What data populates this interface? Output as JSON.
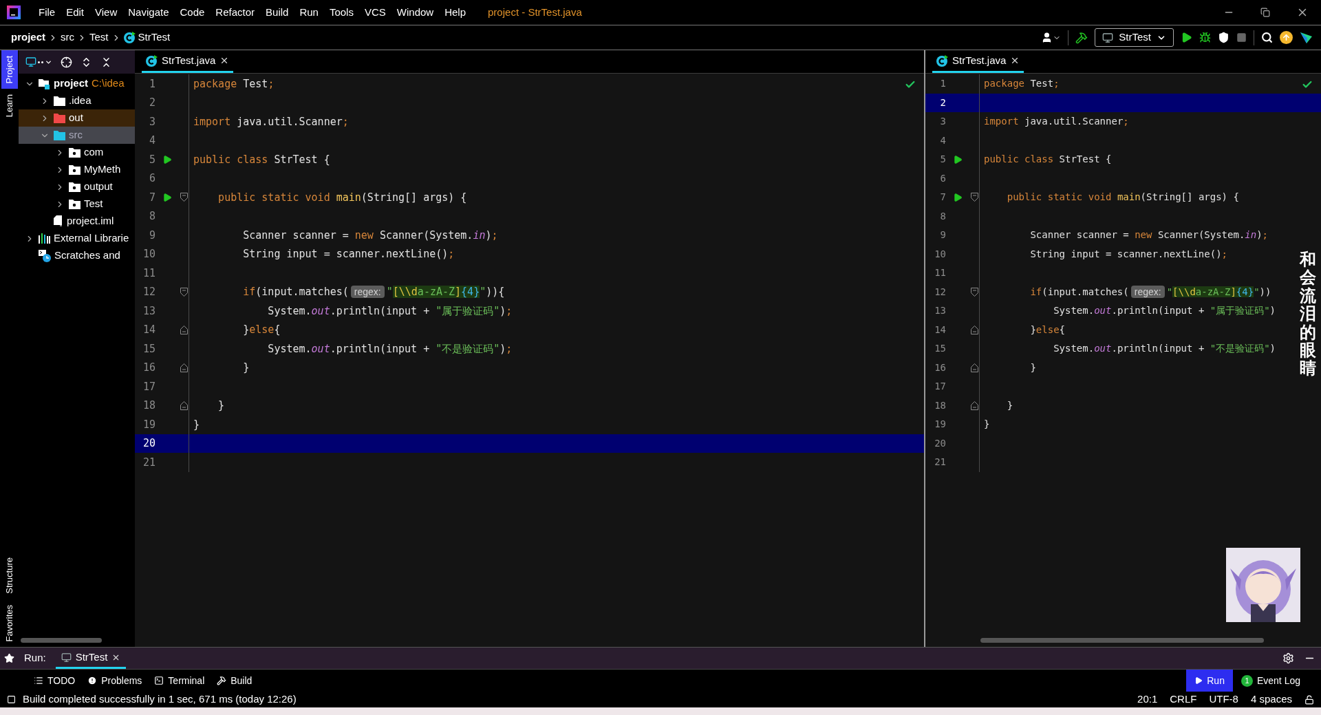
{
  "window": {
    "menu": [
      "File",
      "Edit",
      "View",
      "Navigate",
      "Code",
      "Refactor",
      "Build",
      "Run",
      "Tools",
      "VCS",
      "Window",
      "Help"
    ],
    "title": "project - StrTest.java"
  },
  "breadcrumb": [
    {
      "label": "project",
      "kind": "root"
    },
    {
      "label": "src",
      "kind": "dir"
    },
    {
      "label": "Test",
      "kind": "dir"
    },
    {
      "label": "StrTest",
      "kind": "class"
    }
  ],
  "toolbar": {
    "run_config": "StrTest"
  },
  "tool_strip_top": [
    {
      "label": "Project",
      "selected": true
    },
    {
      "label": "Learn",
      "selected": false
    }
  ],
  "tool_strip_bottom": [
    {
      "label": "Structure",
      "selected": false
    },
    {
      "label": "Favorites",
      "selected": false
    }
  ],
  "project_tree": [
    {
      "label": "project",
      "path": "C:\\idea",
      "kind": "project",
      "expanded": true,
      "selected": false,
      "children": [
        {
          "label": ".idea",
          "kind": "folder",
          "expanded": false,
          "selected": false
        },
        {
          "label": "out",
          "kind": "folder-excluded",
          "expanded": false,
          "selected": false
        },
        {
          "label": "src",
          "kind": "folder-source",
          "expanded": true,
          "selected": true,
          "children": [
            {
              "label": "com",
              "kind": "package",
              "expanded": false,
              "selected": false
            },
            {
              "label": "MyMeth",
              "kind": "package",
              "expanded": false,
              "selected": false
            },
            {
              "label": "output",
              "kind": "package",
              "expanded": false,
              "selected": false
            },
            {
              "label": "Test",
              "kind": "package",
              "expanded": false,
              "selected": false
            }
          ]
        },
        {
          "label": "project.iml",
          "kind": "module-file",
          "selected": false
        }
      ]
    },
    {
      "label": "External Librarie",
      "kind": "library",
      "expanded": false,
      "selected": false
    },
    {
      "label": "Scratches and",
      "kind": "scratch",
      "selected": false
    }
  ],
  "editors": [
    {
      "tab": {
        "label": "StrTest.java",
        "selected": true
      },
      "lines": [
        {
          "n": "1",
          "selected": false,
          "tokens": [
            {
              "kind": "kw",
              "text": "package "
            },
            {
              "kind": "text",
              "text": "Test"
            },
            {
              "kind": "kw",
              "text": ";"
            }
          ]
        },
        {
          "n": "2",
          "selected": false
        },
        {
          "n": "3",
          "selected": false,
          "tokens": [
            {
              "kind": "kw",
              "text": "import "
            },
            {
              "kind": "text",
              "text": "java.util.Scanner"
            },
            {
              "kind": "kw",
              "text": ";"
            }
          ]
        },
        {
          "n": "4",
          "selected": false
        },
        {
          "n": "5",
          "selected": false,
          "gutter": [
            {
              "kind": "run"
            }
          ],
          "tokens": [
            {
              "kind": "kw",
              "text": "public class "
            },
            {
              "kind": "text",
              "text": "StrTest {"
            }
          ]
        },
        {
          "n": "6",
          "selected": false
        },
        {
          "n": "7",
          "selected": false,
          "gutter": [
            {
              "kind": "run"
            },
            {
              "kind": "fold-start"
            }
          ],
          "tokens": [
            {
              "kind": "kw",
              "text": "    public static void "
            },
            {
              "kind": "fn",
              "text": "main"
            },
            {
              "kind": "text",
              "text": "(String[] args) {"
            }
          ]
        },
        {
          "n": "8",
          "selected": false
        },
        {
          "n": "9",
          "selected": false,
          "tokens": [
            {
              "kind": "text",
              "text": "        Scanner scanner = "
            },
            {
              "kind": "kw",
              "text": "new "
            },
            {
              "kind": "text",
              "text": "Scanner(System."
            },
            {
              "kind": "field",
              "text": "in"
            },
            {
              "kind": "text",
              "text": ")"
            },
            {
              "kind": "kw",
              "text": ";"
            }
          ]
        },
        {
          "n": "10",
          "selected": false,
          "tokens": [
            {
              "kind": "text",
              "text": "        String input = scanner.nextLine()"
            },
            {
              "kind": "kw",
              "text": ";"
            }
          ]
        },
        {
          "n": "11",
          "selected": false
        },
        {
          "n": "12",
          "selected": false,
          "gutter": [
            {
              "kind": "fold-start"
            }
          ],
          "tokens": [
            {
              "kind": "kw",
              "text": "        if"
            },
            {
              "kind": "text",
              "text": "(input.matches("
            },
            {
              "kind": "hint",
              "text": "regex:"
            },
            {
              "kind": "str",
              "text": "\""
            },
            {
              "kind": "rx",
              "text": "[\\\\d"
            },
            {
              "kind": "rxs",
              "text": "a-zA-Z"
            },
            {
              "kind": "rx",
              "text": "]"
            },
            {
              "kind": "rxq",
              "text": "{4}"
            },
            {
              "kind": "str",
              "text": "\""
            },
            {
              "kind": "text",
              "text": ")){"
            }
          ]
        },
        {
          "n": "13",
          "selected": false,
          "tokens": [
            {
              "kind": "text",
              "text": "            System."
            },
            {
              "kind": "field",
              "text": "out"
            },
            {
              "kind": "text",
              "text": ".println(input + "
            },
            {
              "kind": "str",
              "text": "\"属于验证码\""
            },
            {
              "kind": "text",
              "text": ")"
            },
            {
              "kind": "kw",
              "text": ";"
            }
          ]
        },
        {
          "n": "14",
          "selected": false,
          "gutter": [
            {
              "kind": "fold-end"
            }
          ],
          "tokens": [
            {
              "kind": "text",
              "text": "        }"
            },
            {
              "kind": "kw",
              "text": "else"
            },
            {
              "kind": "text",
              "text": "{"
            }
          ]
        },
        {
          "n": "15",
          "selected": false,
          "tokens": [
            {
              "kind": "text",
              "text": "            System."
            },
            {
              "kind": "field",
              "text": "out"
            },
            {
              "kind": "text",
              "text": ".println(input + "
            },
            {
              "kind": "str",
              "text": "\"不是验证码\""
            },
            {
              "kind": "text",
              "text": ")"
            },
            {
              "kind": "kw",
              "text": ";"
            }
          ]
        },
        {
          "n": "16",
          "selected": false,
          "gutter": [
            {
              "kind": "fold-end"
            }
          ],
          "tokens": [
            {
              "kind": "text",
              "text": "        }"
            }
          ]
        },
        {
          "n": "17",
          "selected": false
        },
        {
          "n": "18",
          "selected": false,
          "gutter": [
            {
              "kind": "fold-end"
            }
          ],
          "tokens": [
            {
              "kind": "text",
              "text": "    }"
            }
          ]
        },
        {
          "n": "19",
          "selected": false,
          "tokens": [
            {
              "kind": "text",
              "text": "}"
            }
          ]
        },
        {
          "n": "20",
          "selected": true
        },
        {
          "n": "21",
          "selected": false
        }
      ]
    },
    {
      "tab": {
        "label": "StrTest.java",
        "selected": true
      },
      "lines": [
        {
          "n": "1",
          "selected": false,
          "tokens": [
            {
              "kind": "kw",
              "text": "package "
            },
            {
              "kind": "text",
              "text": "Test"
            },
            {
              "kind": "kw",
              "text": ";"
            }
          ]
        },
        {
          "n": "2",
          "selected": true
        },
        {
          "n": "3",
          "selected": false,
          "tokens": [
            {
              "kind": "kw",
              "text": "import "
            },
            {
              "kind": "text",
              "text": "java.util.Scanner"
            },
            {
              "kind": "kw",
              "text": ";"
            }
          ]
        },
        {
          "n": "4",
          "selected": false
        },
        {
          "n": "5",
          "selected": false,
          "gutter": [
            {
              "kind": "run"
            }
          ],
          "tokens": [
            {
              "kind": "kw",
              "text": "public class "
            },
            {
              "kind": "text",
              "text": "StrTest {"
            }
          ]
        },
        {
          "n": "6",
          "selected": false
        },
        {
          "n": "7",
          "selected": false,
          "gutter": [
            {
              "kind": "run"
            },
            {
              "kind": "fold-start"
            }
          ],
          "tokens": [
            {
              "kind": "kw",
              "text": "    public static void "
            },
            {
              "kind": "fn",
              "text": "main"
            },
            {
              "kind": "text",
              "text": "(String[] args) {"
            }
          ]
        },
        {
          "n": "8",
          "selected": false
        },
        {
          "n": "9",
          "selected": false,
          "tokens": [
            {
              "kind": "text",
              "text": "        Scanner scanner = "
            },
            {
              "kind": "kw",
              "text": "new "
            },
            {
              "kind": "text",
              "text": "Scanner(System."
            },
            {
              "kind": "field",
              "text": "in"
            },
            {
              "kind": "text",
              "text": ")"
            },
            {
              "kind": "kw",
              "text": ";"
            }
          ]
        },
        {
          "n": "10",
          "selected": false,
          "tokens": [
            {
              "kind": "text",
              "text": "        String input = scanner.nextLine()"
            },
            {
              "kind": "kw",
              "text": ";"
            }
          ]
        },
        {
          "n": "11",
          "selected": false
        },
        {
          "n": "12",
          "selected": false,
          "gutter": [
            {
              "kind": "fold-start"
            }
          ],
          "tokens": [
            {
              "kind": "kw",
              "text": "        if"
            },
            {
              "kind": "text",
              "text": "(input.matches("
            },
            {
              "kind": "hint",
              "text": "regex:"
            },
            {
              "kind": "str",
              "text": "\""
            },
            {
              "kind": "rx",
              "text": "[\\\\d"
            },
            {
              "kind": "rxs",
              "text": "a-zA-Z"
            },
            {
              "kind": "rx",
              "text": "]"
            },
            {
              "kind": "rxq",
              "text": "{4}"
            },
            {
              "kind": "str",
              "text": "\""
            },
            {
              "kind": "text",
              "text": "))"
            }
          ]
        },
        {
          "n": "13",
          "selected": false,
          "tokens": [
            {
              "kind": "text",
              "text": "            System."
            },
            {
              "kind": "field",
              "text": "out"
            },
            {
              "kind": "text",
              "text": ".println(input + "
            },
            {
              "kind": "str",
              "text": "\"属于验证码\""
            },
            {
              "kind": "text",
              "text": ")"
            }
          ]
        },
        {
          "n": "14",
          "selected": false,
          "gutter": [
            {
              "kind": "fold-end"
            }
          ],
          "tokens": [
            {
              "kind": "text",
              "text": "        }"
            },
            {
              "kind": "kw",
              "text": "else"
            },
            {
              "kind": "text",
              "text": "{"
            }
          ]
        },
        {
          "n": "15",
          "selected": false,
          "tokens": [
            {
              "kind": "text",
              "text": "            System."
            },
            {
              "kind": "field",
              "text": "out"
            },
            {
              "kind": "text",
              "text": ".println(input + "
            },
            {
              "kind": "str",
              "text": "\"不是验证码\""
            },
            {
              "kind": "text",
              "text": ")"
            }
          ]
        },
        {
          "n": "16",
          "selected": false,
          "gutter": [
            {
              "kind": "fold-end"
            }
          ],
          "tokens": [
            {
              "kind": "text",
              "text": "        }"
            }
          ]
        },
        {
          "n": "17",
          "selected": false
        },
        {
          "n": "18",
          "selected": false,
          "gutter": [
            {
              "kind": "fold-end"
            }
          ],
          "tokens": [
            {
              "kind": "text",
              "text": "    }"
            }
          ]
        },
        {
          "n": "19",
          "selected": false,
          "tokens": [
            {
              "kind": "text",
              "text": "}"
            }
          ]
        },
        {
          "n": "20",
          "selected": false
        },
        {
          "n": "21",
          "selected": false
        }
      ]
    }
  ],
  "lyrics_overlay": "和会流泪的眼睛",
  "run_bar": {
    "label": "Run:",
    "tabs": [
      {
        "label": "StrTest",
        "selected": true
      }
    ]
  },
  "tool_windows_left": [
    {
      "label": "TODO",
      "kind": "todo",
      "selected": false
    },
    {
      "label": "Problems",
      "kind": "problems",
      "selected": false
    },
    {
      "label": "Terminal",
      "kind": "terminal",
      "selected": false
    },
    {
      "label": "Build",
      "kind": "build",
      "selected": false
    }
  ],
  "tool_windows_right": [
    {
      "label": "Run",
      "kind": "run",
      "selected": true
    },
    {
      "label": "Event Log",
      "kind": "log",
      "badge": "1",
      "selected": false
    }
  ],
  "status_bar": {
    "message": "Build completed successfully in 1 sec, 671 ms (today 12:26)",
    "items": [
      "20:1",
      "CRLF",
      "UTF-8",
      "4 spaces"
    ]
  }
}
